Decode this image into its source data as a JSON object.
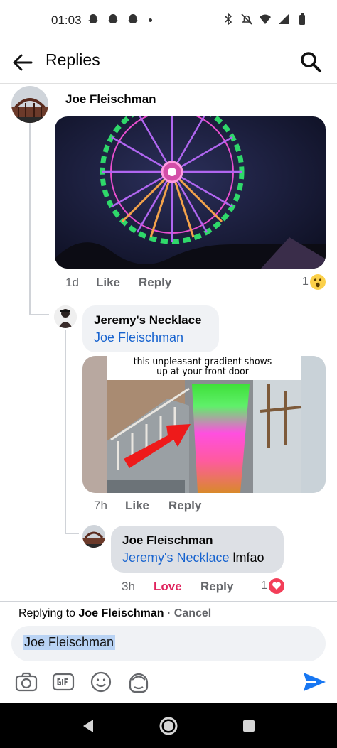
{
  "status_bar": {
    "time": "01:03"
  },
  "header": {
    "title": "Replies"
  },
  "parent_comment": {
    "author": "Joe Fleischman",
    "time": "1d",
    "like_label": "Like",
    "reply_label": "Reply",
    "reaction_count": "1",
    "reaction": "wow-reaction-icon"
  },
  "reply_1": {
    "author": "Jeremy's Necklace",
    "mention": "Joe Fleischman",
    "meme_caption": "this unpleasant gradient shows up at your front door",
    "time": "7h",
    "like_label": "Like",
    "reply_label": "Reply"
  },
  "reply_2": {
    "author": "Joe Fleischman",
    "mention": "Jeremy's Necklace",
    "text": "lmfao",
    "time": "3h",
    "love_label": "Love",
    "reply_label": "Reply",
    "reaction_count": "1",
    "reaction": "love-reaction-icon"
  },
  "composer": {
    "replying_prefix": "Replying to",
    "replying_to": "Joe Fleischman",
    "separator": "·",
    "cancel_label": "Cancel",
    "input_value": "Joe Fleischman"
  },
  "colors": {
    "accent": "#1763cf",
    "love": "#e0245e",
    "send": "#1877f2"
  }
}
